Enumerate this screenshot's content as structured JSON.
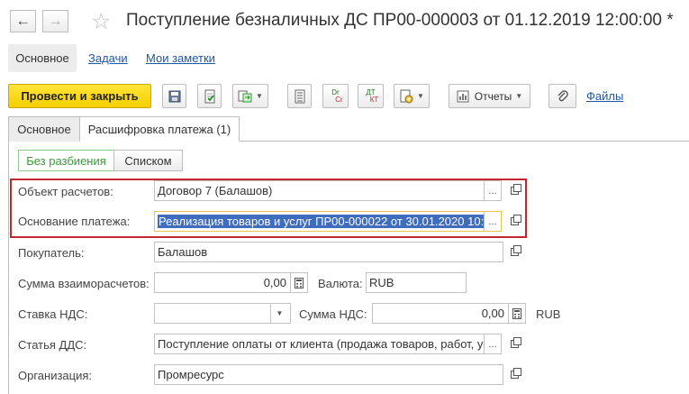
{
  "window": {
    "title": "Поступление безналичных ДС ПР00-000003 от 01.12.2019 12:00:00 *",
    "back_icon": "←",
    "forward_icon": "→",
    "star_icon": "☆"
  },
  "top_tabs": [
    {
      "label": "Основное",
      "active": true
    },
    {
      "label": "Задачи",
      "active": false
    },
    {
      "label": "Мои заметки",
      "active": false
    }
  ],
  "toolbar": {
    "post_close_label": "Провести и закрыть",
    "reports_label": "Отчеты",
    "files_label": "Файлы",
    "dt_kt_label_dr": "Dr",
    "dt_kt_label_cr": "Cr",
    "dt_label": "ДТ",
    "kt_label": "КТ"
  },
  "form_tabs": [
    {
      "label": "Основное",
      "active": false
    },
    {
      "label": "Расшифровка платежа (1)",
      "active": true
    }
  ],
  "split_switch": {
    "no_split": "Без разбиения",
    "list": "Списком"
  },
  "fields": {
    "settlement_object": {
      "label": "Объект расчетов:",
      "value": "Договор 7 (Балашов)"
    },
    "payment_basis": {
      "label": "Основание платежа:",
      "value": "Реализация товаров и услуг ПР00-000022 от 30.01.2020 10:"
    },
    "buyer": {
      "label": "Покупатель:",
      "value": "Балашов"
    },
    "settlement_amount": {
      "label": "Сумма взаиморасчетов:",
      "value": "0,00"
    },
    "currency": {
      "label": "Валюта:",
      "value": "RUB"
    },
    "vat_rate": {
      "label": "Ставка НДС:",
      "value": ""
    },
    "vat_amount": {
      "label": "Сумма НДС:",
      "value": "0,00",
      "unit": "RUB"
    },
    "cash_flow_item": {
      "label": "Статья ДДС:",
      "value": "Поступление оплаты от клиента (продажа товаров, работ, ус"
    },
    "organization": {
      "label": "Организация:",
      "value": "Промресурс"
    }
  },
  "colors": {
    "primary_button": "#f5cf00",
    "link": "#1e57a5",
    "selection": "#3f6cbd",
    "highlight_frame": "#c0282d"
  }
}
